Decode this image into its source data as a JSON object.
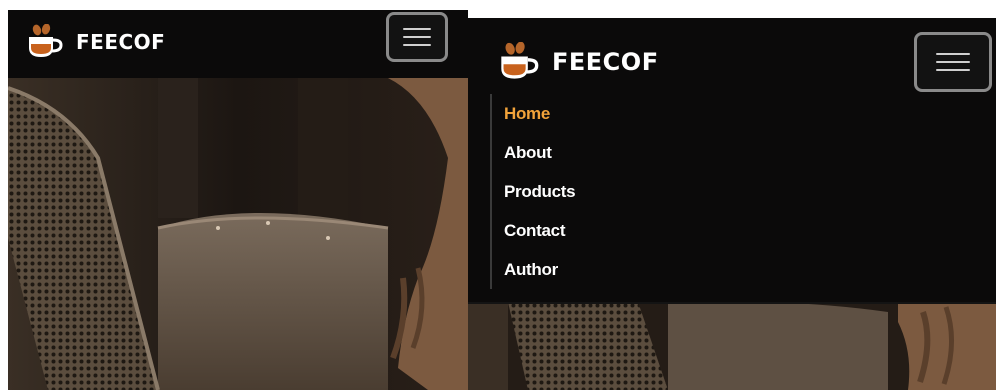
{
  "left": {
    "brand": {
      "name": "FEECOF",
      "icon": "coffee-cup-icon"
    },
    "toggler": {
      "icon": "hamburger-menu-icon"
    }
  },
  "right": {
    "brand": {
      "name": "FEECOF",
      "icon": "coffee-cup-icon"
    },
    "toggler": {
      "icon": "hamburger-menu-icon"
    },
    "menu": [
      {
        "label": "Home",
        "active": true
      },
      {
        "label": "About",
        "active": false
      },
      {
        "label": "Products",
        "active": false
      },
      {
        "label": "Contact",
        "active": false
      },
      {
        "label": "Author",
        "active": false
      }
    ]
  },
  "colors": {
    "navbar_bg": "#0b0a0a",
    "active_link": "#f2a33a",
    "link": "#ffffff",
    "cup_white": "#ffffff",
    "cup_coffee": "#c8621d",
    "beans": "#b5652a"
  }
}
